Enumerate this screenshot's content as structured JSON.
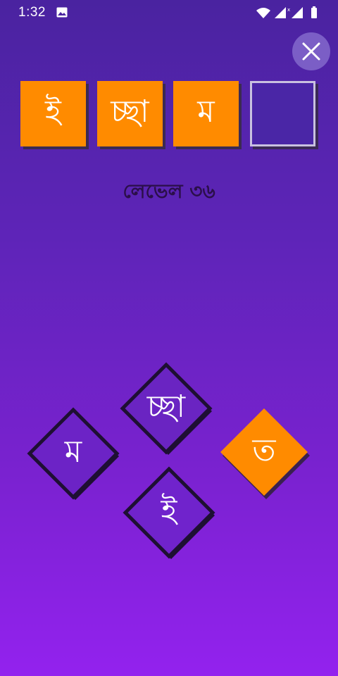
{
  "status_bar": {
    "time": "1:32",
    "icons": [
      "image-icon",
      "wifi-icon",
      "signal-icon",
      "signal-icon",
      "battery-icon"
    ]
  },
  "close_button": {
    "icon": "close-icon"
  },
  "answer": {
    "slots": [
      {
        "letter": "ই",
        "filled": true
      },
      {
        "letter": "চ্ছা",
        "filled": true
      },
      {
        "letter": "ম",
        "filled": true
      },
      {
        "letter": "",
        "filled": false
      }
    ]
  },
  "level": {
    "label": "লেভেল ৩৬"
  },
  "tiles": [
    {
      "letter": "চ্ছা",
      "state": "outline"
    },
    {
      "letter": "ম",
      "state": "outline"
    },
    {
      "letter": "ত",
      "state": "filled"
    },
    {
      "letter": "ই",
      "state": "outline"
    }
  ],
  "colors": {
    "accent": "#ff8b00",
    "tile_outline": "#1e0f33",
    "text": "#ffffff",
    "level_text": "#2b0f4a"
  }
}
